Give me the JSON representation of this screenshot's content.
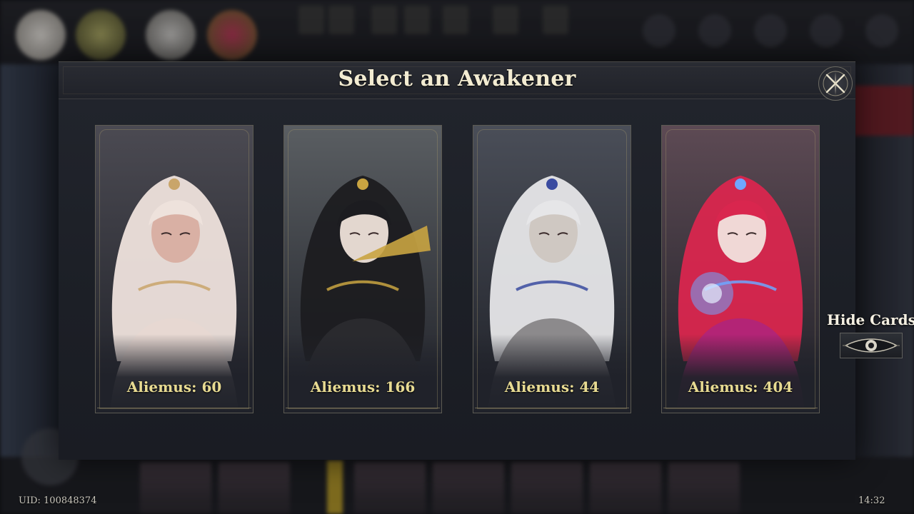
{
  "modal": {
    "title": "Select an Awakener"
  },
  "cards": [
    {
      "label": "Aliemus: 60",
      "palette": {
        "hair": "#eee2dc",
        "accent": "#c9a56a",
        "bg": "#4b4a52",
        "skin": "#d9b0a4",
        "robe": "#e7d8d2"
      }
    },
    {
      "label": "Aliemus: 166",
      "palette": {
        "hair": "#1c1c20",
        "accent": "#c9a441",
        "bg": "#5a5e62",
        "skin": "#e3d7cf",
        "robe": "#2a2a2e"
      }
    },
    {
      "label": "Aliemus: 44",
      "palette": {
        "hair": "#e6e6e8",
        "accent": "#3a4ba0",
        "bg": "#4a4e58",
        "skin": "#cfc8c2",
        "robe": "#8c8a8c"
      }
    },
    {
      "label": "Aliemus: 404",
      "palette": {
        "hair": "#d9264e",
        "accent": "#6fa6ff",
        "bg": "#5d4a54",
        "skin": "#f0d8d6",
        "robe": "#b32476"
      }
    }
  ],
  "hide_cards": {
    "label": "Hide Cards",
    "icon": "eye-icon"
  },
  "footer": {
    "uid": "UID: 100848374",
    "time": "14:32"
  },
  "colors": {
    "title": "#f3ecd2",
    "card_label": "#e8db92",
    "modal_bg": "#1f2229"
  }
}
